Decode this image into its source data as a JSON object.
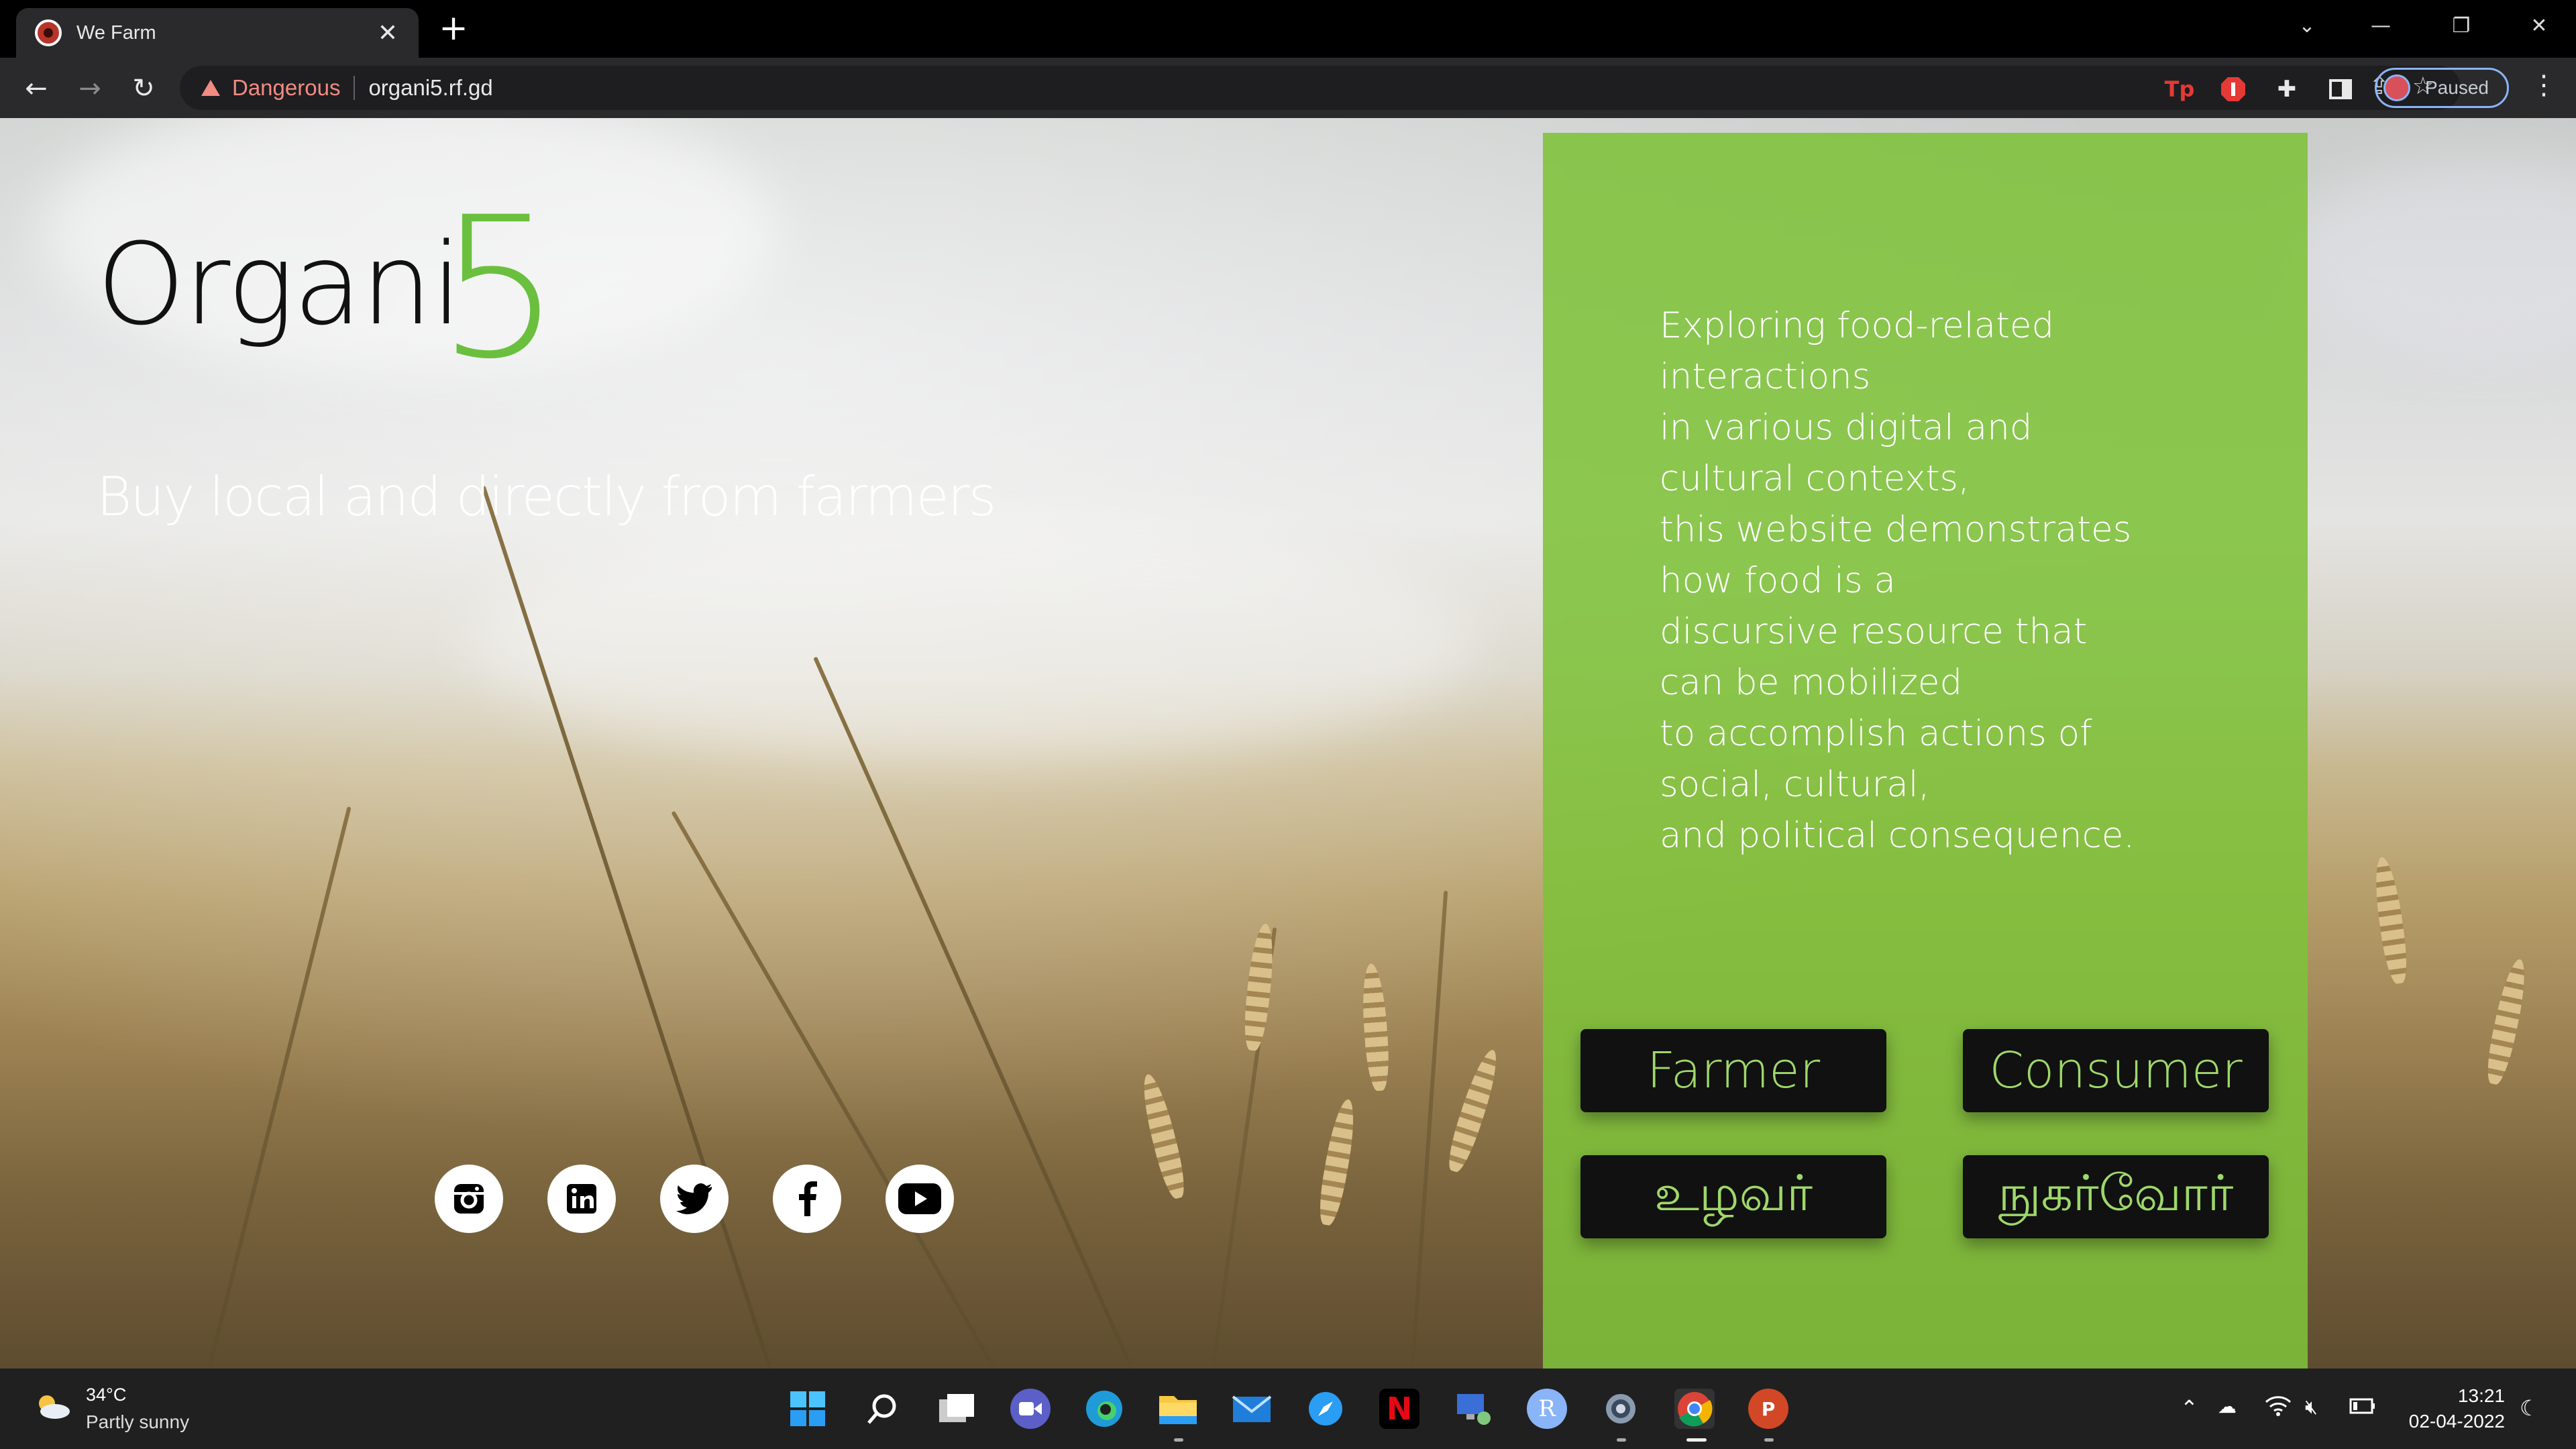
{
  "browser": {
    "tab_title": "We Farm",
    "security_label": "Dangerous",
    "url": "organi5.rf.gd",
    "profile_status": "Paused"
  },
  "page": {
    "logo_text": "Organi",
    "logo_number": "5",
    "tagline": "Buy local and directly from farmers",
    "blurb_lines": [
      "Exploring food-related",
      "interactions",
      "in various digital and",
      "cultural contexts,",
      "this website demonstrates",
      "how food is a",
      "discursive resource that",
      "can be mobilized",
      "to accomplish actions of",
      "social, cultural,",
      "and political consequence."
    ],
    "buttons": {
      "farmer": "Farmer",
      "consumer": "Consumer",
      "farmer_tamil": "உழவர்",
      "consumer_tamil": "நுகர்வோர்"
    },
    "socials": [
      "instagram-icon",
      "linkedin-icon",
      "twitter-icon",
      "facebook-icon",
      "youtube-icon"
    ],
    "colors": {
      "accent_green": "#6bbf3e",
      "panel_green": "#7ec13a",
      "button_bg": "#111111",
      "button_text": "#9fd86a"
    }
  },
  "taskbar": {
    "temperature": "34°C",
    "weather": "Partly sunny",
    "time": "13:21",
    "date": "02-04-2022"
  }
}
